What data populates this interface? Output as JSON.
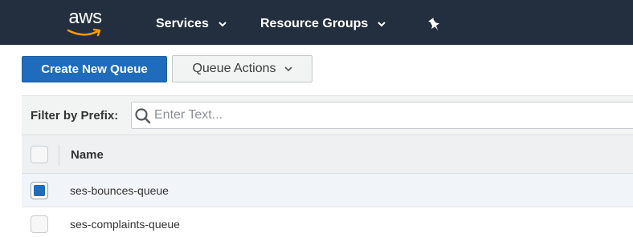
{
  "nav": {
    "logo": "aws",
    "services": "Services",
    "resource_groups": "Resource Groups"
  },
  "toolbar": {
    "create_label": "Create New Queue",
    "actions_label": "Queue Actions"
  },
  "filter": {
    "label": "Filter by Prefix:",
    "placeholder": "Enter Text..."
  },
  "table": {
    "column_name": "Name",
    "rows": [
      {
        "name": "ses-bounces-queue",
        "checked": true
      },
      {
        "name": "ses-complaints-queue",
        "checked": false
      }
    ]
  },
  "colors": {
    "nav_bg": "#232f3e",
    "primary": "#1f6cbd",
    "aws_smile": "#ff9900"
  }
}
